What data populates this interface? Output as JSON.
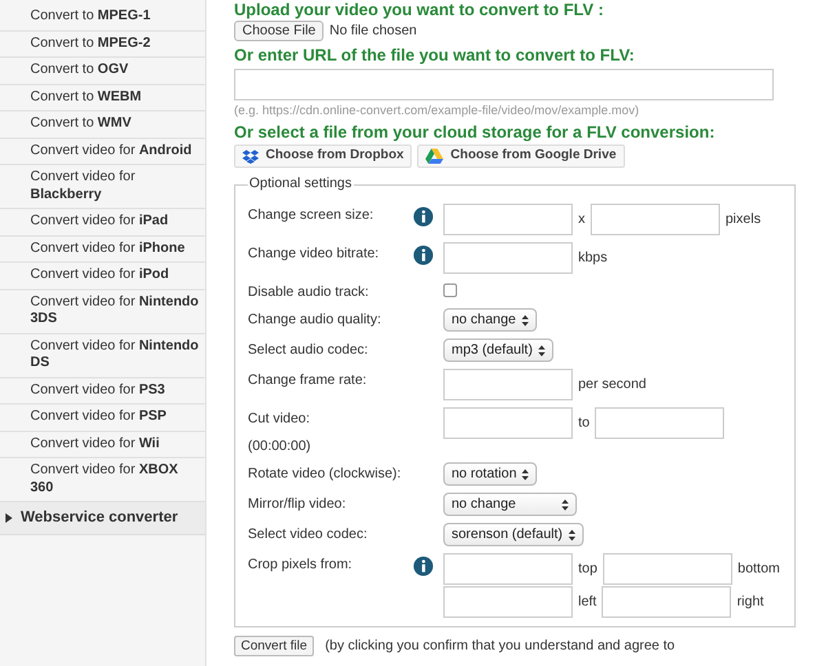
{
  "sidebar": {
    "items": [
      {
        "label": "Convert to **MPEG-1**"
      },
      {
        "label": "Convert to **MPEG-2**"
      },
      {
        "label": "Convert to **OGV**"
      },
      {
        "label": "Convert to **WEBM**"
      },
      {
        "label": "Convert to **WMV**"
      },
      {
        "label": "Convert video for **Android**"
      },
      {
        "label": "Convert video for **Blackberry**"
      },
      {
        "label": "Convert video for **iPad**"
      },
      {
        "label": "Convert video for **iPhone**"
      },
      {
        "label": "Convert video for **iPod**"
      },
      {
        "label": "Convert video for **Nintendo 3DS**"
      },
      {
        "label": "Convert video for **Nintendo DS**"
      },
      {
        "label": "Convert video for **PS3**"
      },
      {
        "label": "Convert video for **PSP**"
      },
      {
        "label": "Convert video for **Wii**"
      },
      {
        "label": "Convert video for **XBOX 360**"
      }
    ],
    "section": {
      "label": "Webservice converter",
      "expanded": false
    }
  },
  "upload": {
    "heading": "Upload your video you want to convert to FLV :",
    "button": "Choose File",
    "status": "No file chosen"
  },
  "url": {
    "heading": "Or enter URL of the file you want to convert to FLV:",
    "hint": "(e.g. https://cdn.online-convert.com/example-file/video/mov/example.mov)"
  },
  "cloud": {
    "heading": "Or select a file from your cloud storage for a FLV conversion:",
    "buttons": [
      {
        "kind": "dropbox",
        "label": "Choose from Dropbox"
      },
      {
        "kind": "drive",
        "label": "Choose from Google Drive"
      }
    ]
  },
  "settings": {
    "legend": "Optional settings",
    "rows": [
      {
        "kind": "fields",
        "label": "Change screen size:",
        "info": true,
        "lines": [
          [
            {
              "after": "x"
            },
            {
              "after": "pixels"
            }
          ]
        ]
      },
      {
        "kind": "fields",
        "label": "Change video bitrate:",
        "info": true,
        "lines": [
          [
            {
              "after": "kbps"
            }
          ]
        ]
      },
      {
        "kind": "checkbox",
        "label": "Disable audio track:",
        "checked": false
      },
      {
        "kind": "select",
        "label": "Change audio quality:",
        "value": "no change"
      },
      {
        "kind": "select",
        "label": "Select audio codec:",
        "value": "mp3 (default)"
      },
      {
        "kind": "fields",
        "label": "Change frame rate:",
        "lines": [
          [
            {
              "after": "per second"
            }
          ]
        ]
      },
      {
        "kind": "fields",
        "label": "Cut video:",
        "note": "(00:00:00)",
        "lines": [
          [
            {
              "after": "to"
            },
            {
              "kind": "field"
            }
          ]
        ]
      },
      {
        "kind": "select",
        "label": "Rotate video (clockwise):",
        "value": "no rotation"
      },
      {
        "kind": "select",
        "label": "Mirror/flip video:",
        "value": "no change",
        "wide": true
      },
      {
        "kind": "select",
        "label": "Select video codec:",
        "value": "sorenson (default)"
      },
      {
        "kind": "fields",
        "label": "Crop pixels from:",
        "info": true,
        "lines": [
          [
            {
              "after": "top"
            },
            {
              "after": "bottom"
            }
          ],
          [
            {
              "after": "left"
            },
            {
              "after": "right"
            }
          ]
        ]
      }
    ]
  },
  "submit": {
    "button": "Convert file",
    "note": "(by clicking you confirm that you understand and agree to"
  }
}
